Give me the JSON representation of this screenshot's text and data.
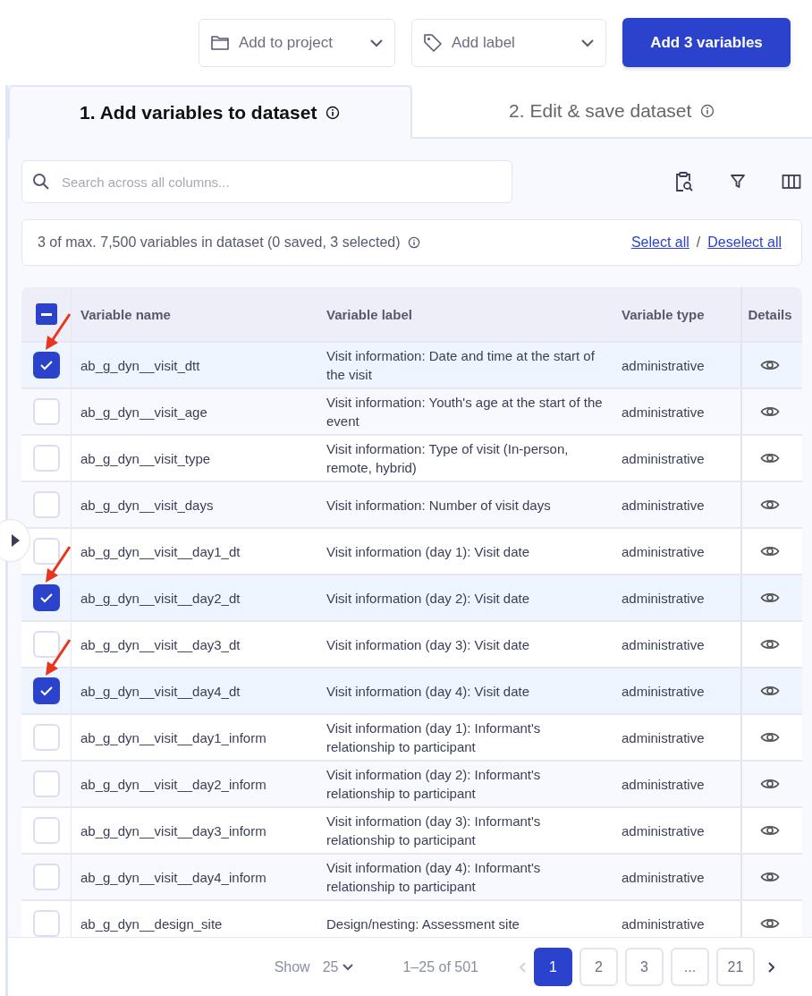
{
  "toolbar": {
    "project_select": {
      "placeholder": "Add to project"
    },
    "label_select": {
      "placeholder": "Add label"
    },
    "add_button": "Add 3 variables"
  },
  "tabs": [
    {
      "label": "1. Add variables to dataset",
      "selected": true
    },
    {
      "label": "2. Edit & save dataset",
      "selected": false
    }
  ],
  "search": {
    "placeholder": "Search across all columns..."
  },
  "summary": {
    "text": "3 of max. 7,500 variables in dataset (0 saved, 3 selected)",
    "select_all": "Select all",
    "separator": "/",
    "deselect_all": "Deselect all"
  },
  "table": {
    "header_checkbox": {
      "indeterminate": true
    },
    "columns": [
      "Variable name",
      "Variable label",
      "Variable type",
      "Details"
    ],
    "rows": [
      {
        "name": "ab_g_dyn__visit_dtt",
        "label": "Visit information: Date and time at the start of the visit",
        "type": "administrative",
        "selected": true
      },
      {
        "name": "ab_g_dyn__visit_age",
        "label": "Visit information: Youth's age at the start of the event",
        "type": "administrative",
        "selected": false
      },
      {
        "name": "ab_g_dyn__visit_type",
        "label": "Visit information: Type of visit (In-person, remote, hybrid)",
        "type": "administrative",
        "selected": false
      },
      {
        "name": "ab_g_dyn__visit_days",
        "label": "Visit information: Number of visit days",
        "type": "administrative",
        "selected": false
      },
      {
        "name": "ab_g_dyn__visit__day1_dt",
        "label": "Visit information (day 1): Visit date",
        "type": "administrative",
        "selected": false
      },
      {
        "name": "ab_g_dyn__visit__day2_dt",
        "label": "Visit information (day 2): Visit date",
        "type": "administrative",
        "selected": true
      },
      {
        "name": "ab_g_dyn__visit__day3_dt",
        "label": "Visit information (day 3): Visit date",
        "type": "administrative",
        "selected": false
      },
      {
        "name": "ab_g_dyn__visit__day4_dt",
        "label": "Visit information (day 4): Visit date",
        "type": "administrative",
        "selected": true
      },
      {
        "name": "ab_g_dyn__visit__day1_inform",
        "label": "Visit information (day 1): Informant's relationship to participant",
        "type": "administrative",
        "selected": false
      },
      {
        "name": "ab_g_dyn__visit__day2_inform",
        "label": "Visit information (day 2): Informant's relationship to participant",
        "type": "administrative",
        "selected": false
      },
      {
        "name": "ab_g_dyn__visit__day3_inform",
        "label": "Visit information (day 3): Informant's relationship to participant",
        "type": "administrative",
        "selected": false
      },
      {
        "name": "ab_g_dyn__visit__day4_inform",
        "label": "Visit information (day 4): Informant's relationship to participant",
        "type": "administrative",
        "selected": false
      },
      {
        "name": "ab_g_dyn__design_site",
        "label": "Design/nesting: Assessment site",
        "type": "administrative",
        "selected": false
      }
    ]
  },
  "pagination": {
    "show_label": "Show",
    "page_size": "25",
    "range": "1–25 of 501",
    "prev_disabled": true,
    "pages": [
      {
        "label": "1",
        "selected": true
      },
      {
        "label": "2",
        "selected": false
      },
      {
        "label": "3",
        "selected": false
      },
      {
        "label": "...",
        "selected": false
      },
      {
        "label": "21",
        "selected": false
      }
    ]
  }
}
